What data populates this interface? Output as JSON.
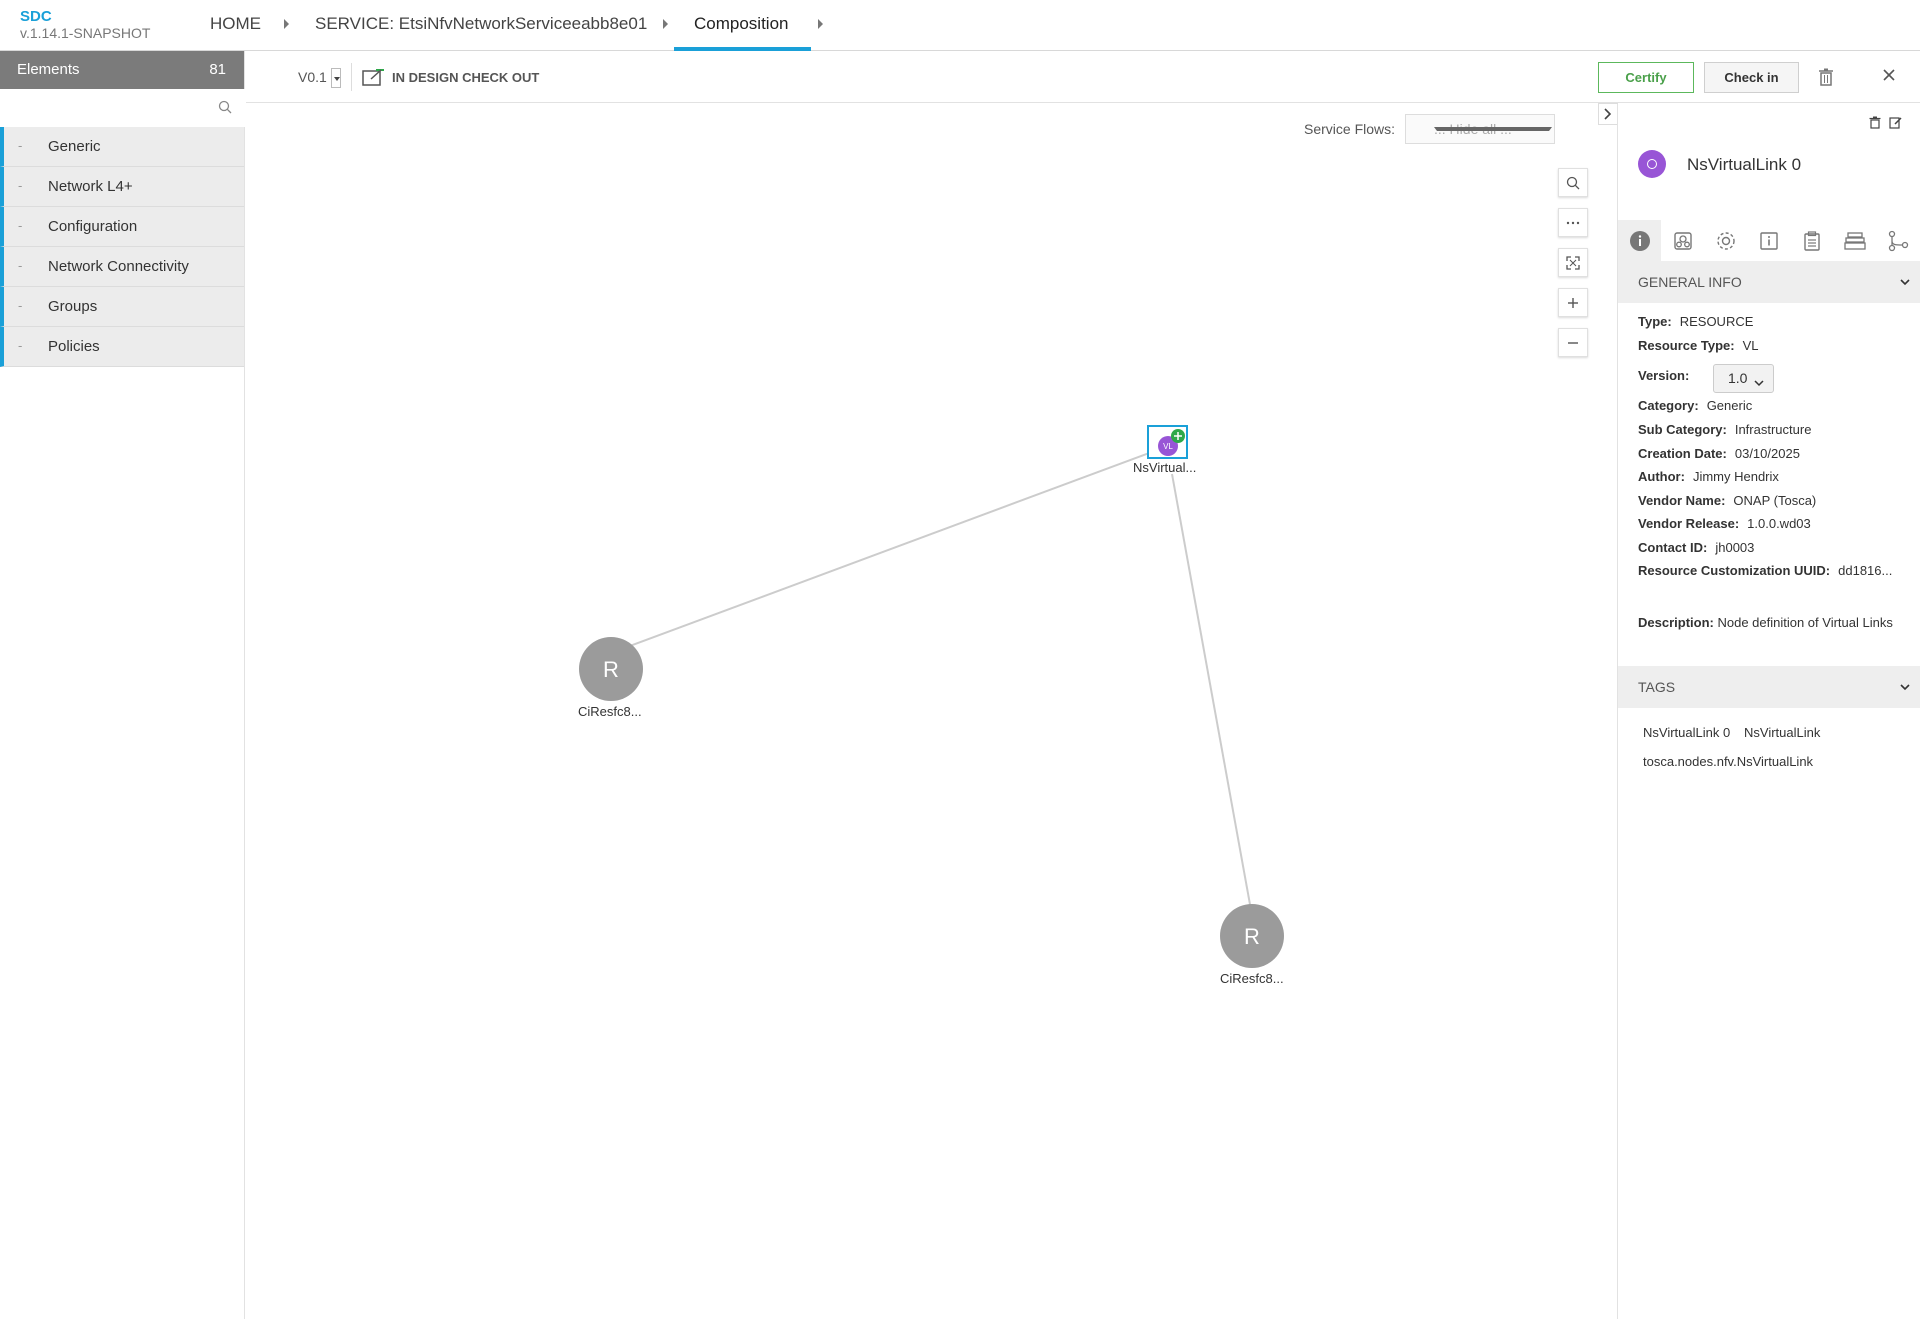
{
  "app": {
    "name": "SDC",
    "version": "v.1.14.1-SNAPSHOT"
  },
  "breadcrumb": {
    "home": "HOME",
    "service": "SERVICE: EtsiNfvNetworkServiceeabb8e01",
    "active": "Composition"
  },
  "palette": {
    "title": "Elements",
    "count": "81",
    "search_placeholder": "",
    "categories": [
      {
        "dash": "-",
        "label": "Generic"
      },
      {
        "dash": "-",
        "label": "Network L4+"
      },
      {
        "dash": "-",
        "label": "Configuration"
      },
      {
        "dash": "-",
        "label": "Network Connectivity"
      },
      {
        "dash": "-",
        "label": "Groups"
      },
      {
        "dash": "-",
        "label": "Policies"
      }
    ]
  },
  "toolbar": {
    "version": "V0.1",
    "status": "IN DESIGN CHECK OUT",
    "certify_label": "Certify",
    "checkin_label": "Check in"
  },
  "canvas": {
    "service_flows_label": "Service Flows:",
    "service_flows_value": "... Hide all ...",
    "zoom_controls": [
      "search-icon",
      "more-icon",
      "fit-icon",
      "zoom-in-icon",
      "zoom-out-icon"
    ],
    "nodes": [
      {
        "id": "vl",
        "label": "NsVirtual...",
        "badge": "VL",
        "badge_color": "#9855d6",
        "add_color": "#2ea84a"
      },
      {
        "id": "r1",
        "label": "CiResfc8...",
        "letter": "R",
        "color": "#9b9b9b"
      },
      {
        "id": "r2",
        "label": "CiResfc8...",
        "letter": "R",
        "color": "#9b9b9b"
      }
    ]
  },
  "panel": {
    "title": "NsVirtualLink 0",
    "tabs": [
      "info-icon",
      "deployment-artifacts-icon",
      "properties-icon",
      "information-artifacts-icon",
      "api-artifacts-icon",
      "composition-icon",
      "relations-icon"
    ],
    "general_info": {
      "header": "GENERAL INFO",
      "type_label": "Type:",
      "type": "RESOURCE",
      "resource_type_label": "Resource Type:",
      "resource_type": "VL",
      "version_label": "Version:",
      "version": "1.0",
      "category_label": "Category:",
      "category": "Generic",
      "subcategory_label": "Sub Category:",
      "subcategory": "Infrastructure",
      "creation_date_label": "Creation Date:",
      "creation_date": "03/10/2025",
      "author_label": "Author:",
      "author": "Jimmy Hendrix",
      "vendor_name_label": "Vendor Name:",
      "vendor_name": "ONAP (Tosca)",
      "vendor_release_label": "Vendor Release:",
      "vendor_release": "1.0.0.wd03",
      "contact_id_label": "Contact ID:",
      "contact_id": "jh0003",
      "uuid_label": "Resource Customization UUID:",
      "uuid": "dd1816...",
      "description_label": "Description:",
      "description": "Node definition of Virtual Links"
    },
    "tags": {
      "header": "TAGS",
      "items": [
        "NsVirtualLink 0",
        "NsVirtualLink",
        "tosca.nodes.nfv.NsVirtualLink"
      ]
    }
  }
}
